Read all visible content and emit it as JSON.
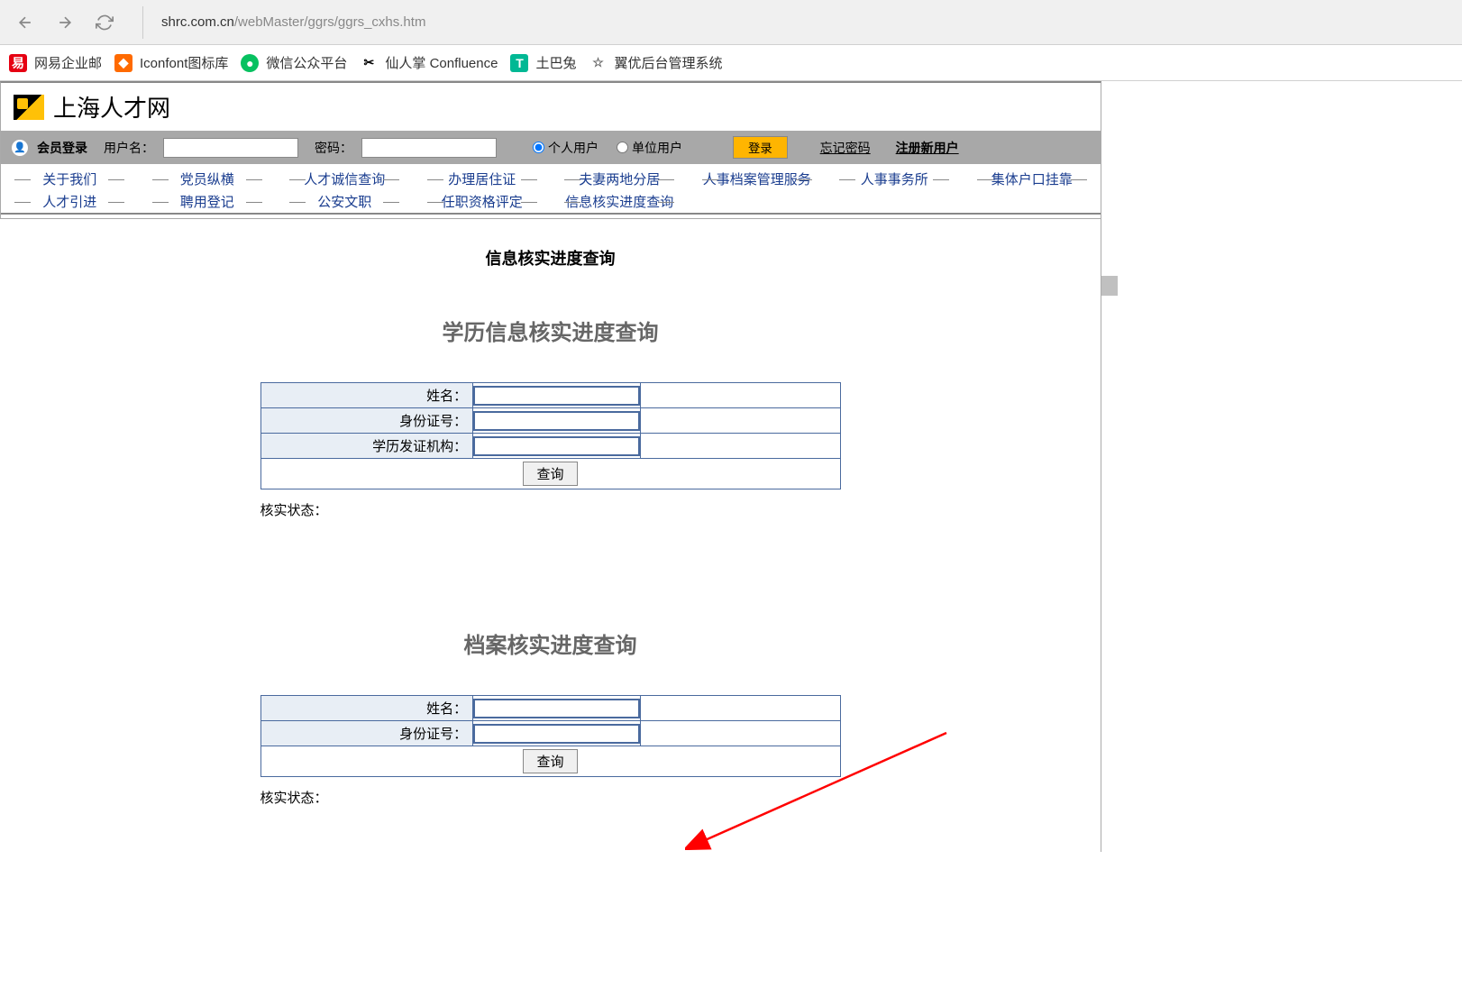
{
  "browser": {
    "url_domain": "shrc.com.cn",
    "url_path": "/webMaster/ggrs/ggrs_cxhs.htm"
  },
  "bookmarks": [
    {
      "icon": "易",
      "icon_class": "icon-red",
      "label": "网易企业邮"
    },
    {
      "icon": "◆",
      "icon_class": "icon-orange",
      "label": "Iconfont图标库"
    },
    {
      "icon": "●",
      "icon_class": "icon-green",
      "label": "微信公众平台"
    },
    {
      "icon": "✂",
      "icon_class": "icon-scissors",
      "label": "仙人掌 Confluence"
    },
    {
      "icon": "T",
      "icon_class": "icon-teal",
      "label": "土巴兔"
    },
    {
      "icon": "☆",
      "icon_class": "icon-star",
      "label": "翼优后台管理系统"
    }
  ],
  "site": {
    "title": "上海人才网"
  },
  "login": {
    "title": "会员登录",
    "username_label": "用户名：",
    "password_label": "密码：",
    "radio_personal": "个人用户",
    "radio_company": "单位用户",
    "login_btn": "登录",
    "forgot": "忘记密码",
    "register": "注册新用户"
  },
  "nav": {
    "row1": [
      "关于我们",
      "党员纵横",
      "人才诚信查询",
      "办理居住证",
      "夫妻两地分居",
      "人事档案管理服务",
      "人事事务所",
      "集体户口挂靠"
    ],
    "row2": [
      "人才引进",
      "聘用登记",
      "公安文职",
      "任职资格评定",
      "信息核实进度查询"
    ]
  },
  "main": {
    "page_heading": "信息核实进度查询",
    "section1": {
      "title": "学历信息核实进度查询",
      "fields": [
        "姓名：",
        "身份证号：",
        "学历发证机构："
      ],
      "query_btn": "查询",
      "status": "核实状态："
    },
    "section2": {
      "title": "档案核实进度查询",
      "fields": [
        "姓名：",
        "身份证号："
      ],
      "query_btn": "查询",
      "status": "核实状态："
    }
  }
}
